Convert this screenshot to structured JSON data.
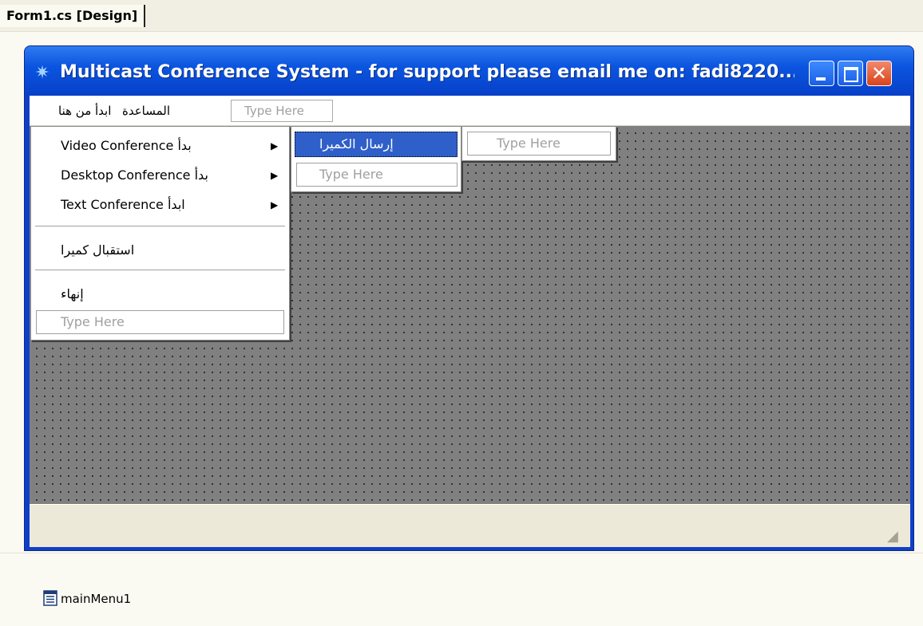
{
  "designer": {
    "tab_title": "Form1.cs [Design]"
  },
  "window": {
    "title": "Multicast Conference System - for support please email me on: fadi8220...",
    "app_icon": "satellite-icon",
    "close_glyph": "✕",
    "caption_buttons": [
      "minimize",
      "maximize",
      "close"
    ]
  },
  "menubar": {
    "items": [
      {
        "label": "ابدأ من هنا"
      },
      {
        "label": "المساعدة"
      }
    ],
    "type_here": "Type Here"
  },
  "dropdown": {
    "items": [
      {
        "label": "Video Conference بدأ",
        "has_submenu": true
      },
      {
        "label": "Desktop Conference بدأ",
        "has_submenu": true
      },
      {
        "label": "Text Conference ابدأ",
        "has_submenu": true
      },
      {
        "label": "استقبال كميرا",
        "has_submenu": false
      },
      {
        "label": "إنهاء",
        "has_submenu": false
      }
    ],
    "submenu_arrow": "▶",
    "type_here": "Type Here"
  },
  "submenu": {
    "selected_item": "إرسال الكميرا",
    "type_here": "Type Here",
    "nested_type_here": "Type Here"
  },
  "tray": {
    "component": "mainMenu1",
    "component_icon": "main-menu-icon"
  },
  "colors": {
    "titlebar": "#0b55e0",
    "selection": "#2f5fc9",
    "design_surface": "#808080"
  }
}
